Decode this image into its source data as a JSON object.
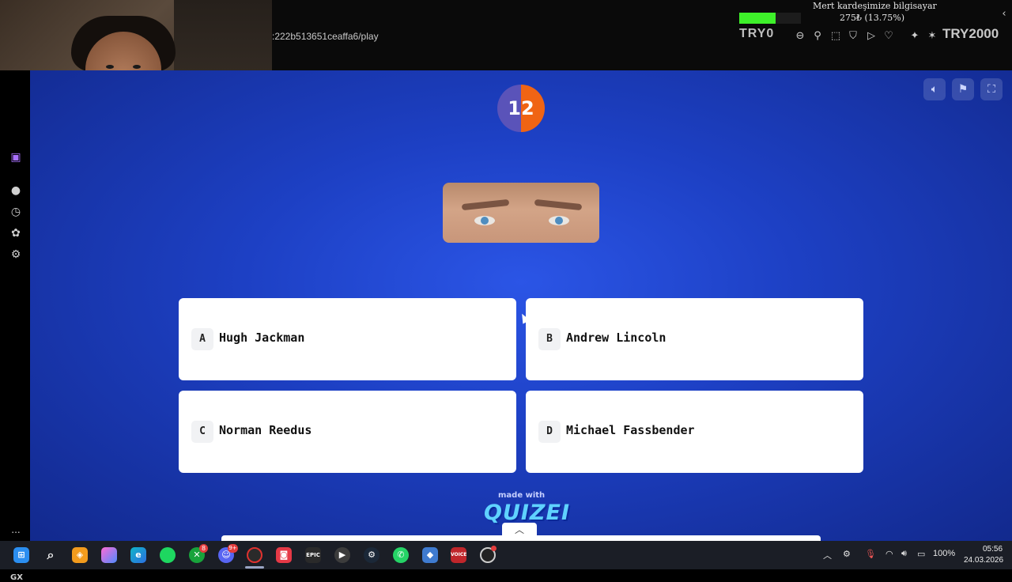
{
  "browser": {
    "url_fragment": ":222b513651ceaffa6/play"
  },
  "stream_overlay": {
    "donation_title": "Mert kardeşimize bilgisayar",
    "donation_amount": "275₺ (13.75%)",
    "donation_progress": 0.1375,
    "label_left": "TRY0",
    "label_right": "TRY2000",
    "accent_color": "#3ef02a"
  },
  "sidebar": {
    "items": [
      {
        "icon": "twitch-icon"
      },
      {
        "icon": "spotify-icon"
      },
      {
        "icon": "history-icon"
      },
      {
        "icon": "extensions-icon"
      },
      {
        "icon": "settings-icon"
      }
    ],
    "gx_label": "GX",
    "more_label": "..."
  },
  "quiz": {
    "timer": "12",
    "timer_progress": 0.5,
    "answers": [
      {
        "letter": "A",
        "label": "Hugh Jackman"
      },
      {
        "letter": "B",
        "label": "Andrew Lincoln"
      },
      {
        "letter": "C",
        "label": "Norman Reedus"
      },
      {
        "letter": "D",
        "label": "Michael Fassbender"
      }
    ],
    "footer": {
      "made_with": "made with",
      "brand": "QUIZEI"
    },
    "controls": [
      "sound-icon",
      "flag-icon",
      "fullscreen-icon"
    ],
    "colors": {
      "background": "#1d40c4",
      "timer_orange": "#f06414",
      "timer_purple": "#5a53b9"
    }
  },
  "taskbar": {
    "apps": [
      "windows-icon",
      "search-icon",
      "vpn-icon",
      "copilot-icon",
      "edge-icon",
      "spotify-icon",
      "xbox-icon",
      "discord-icon",
      "opera-gx-icon",
      "eggman-icon",
      "epic-games-icon",
      "media-player-icon",
      "steam-icon",
      "whatsapp-icon",
      "app-icon",
      "voicemeeter-icon",
      "obs-icon"
    ],
    "xbox_badge": "8",
    "discord_badge": "9+",
    "epic_label": "EPIC",
    "voice_label": "VOICE",
    "battery": "100%",
    "time": "05:56",
    "date": "24.03.2026"
  }
}
